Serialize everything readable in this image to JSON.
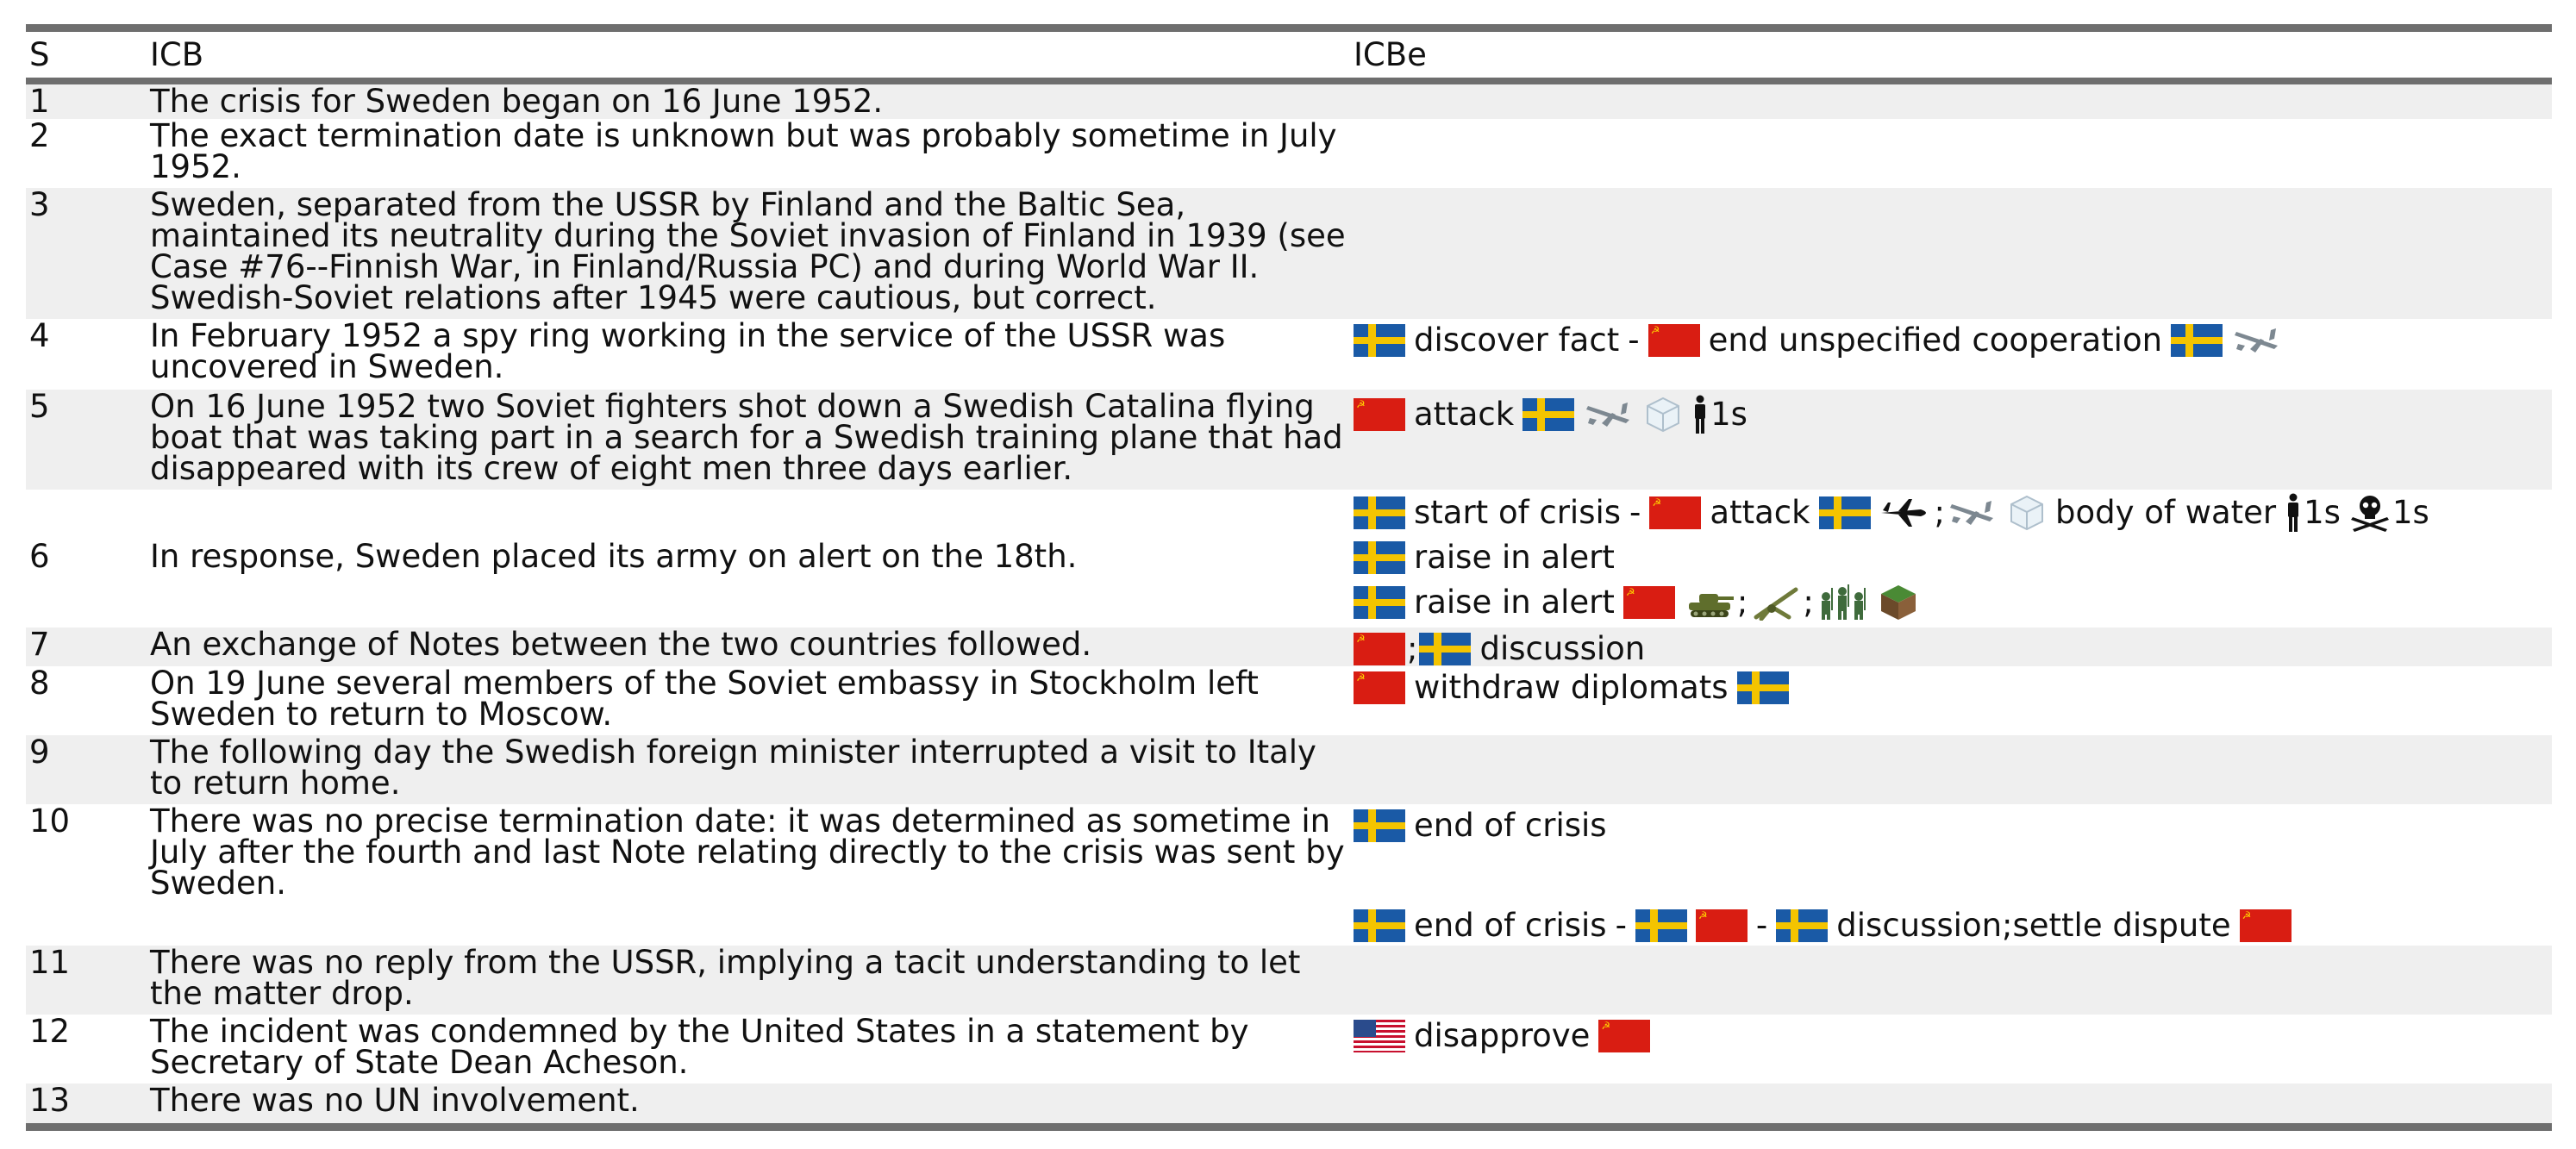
{
  "header": {
    "s": "S",
    "icb": "ICB",
    "icbe": "ICBe"
  },
  "colors": {
    "rule": "#6e6e6e",
    "stripe": "#efefef",
    "sweden_blue": "#1a5aa6",
    "sweden_yellow": "#f4c400",
    "ussr_red": "#d91d12"
  },
  "rows": [
    {
      "s": "1",
      "icb": "The crisis for Sweden began on 16 June 1952."
    },
    {
      "s": "2",
      "icb": "The exact termination date is unknown but was probably sometime in July 1952."
    },
    {
      "s": "3",
      "icb": "Sweden, separated from the USSR by Finland and the Baltic Sea, maintained its neutrality during the Soviet invasion of Finland in 1939 (see Case #76--Finnish War, in Finland/Russia PC) and during World War II. Swedish-Soviet relations after 1945 were cautious, but correct."
    },
    {
      "s": "4",
      "icb": "In February 1952 a spy ring working in the service of the USSR was uncovered in Sweden."
    },
    {
      "s": "5",
      "icb": "On 16 June 1952 two Soviet fighters shot down a Swedish Catalina flying boat that was taking part in a search for a Swedish training plane that had disappeared with its crew of eight men three days earlier."
    },
    {
      "s": "6",
      "icb": "In response, Sweden placed its army on alert on the 18th."
    },
    {
      "s": "7",
      "icb": "An exchange of Notes between the two countries followed."
    },
    {
      "s": "8",
      "icb": "On 19 June several members of the Soviet embassy in Stockholm left Sweden to return to Moscow."
    },
    {
      "s": "9",
      "icb": "The following day the Swedish foreign minister interrupted a visit to Italy to return home."
    },
    {
      "s": "10",
      "icb": "There was no precise termination date: it was determined as sometime in July after the fourth and last Note relating directly to the crisis was sent by Sweden."
    },
    {
      "s": "11",
      "icb": "There was no reply from the USSR, implying a tacit understanding to let the matter drop."
    },
    {
      "s": "12",
      "icb": "The incident was condemned by the United States in a statement by Secretary of State Dean Acheson."
    },
    {
      "s": "13",
      "icb": "There was no UN involvement."
    }
  ],
  "events": {
    "r4": {
      "discover": "discover fact",
      "dash": "-",
      "end_coop": "end unspecified cooperation"
    },
    "r5": {
      "attack": "attack",
      "water": "body of water",
      "count": "1s"
    },
    "r6a": {
      "start": "start of crisis",
      "dash": "-",
      "attack": "attack",
      "semi": ";",
      "water": "body of water",
      "count1": "1s",
      "count2": "1s"
    },
    "r6b": {
      "alert": "raise in alert"
    },
    "r6c": {
      "alert": "raise in alert",
      "semi1": ";",
      "semi2": ";"
    },
    "r7": {
      "semi": ";",
      "discussion": "discussion"
    },
    "r8": {
      "withdraw": "withdraw diplomats"
    },
    "r10a": {
      "end": "end of crisis"
    },
    "r10b": {
      "end": "end of crisis",
      "dash1": "-",
      "dash2": "-",
      "discuss": "discussion;settle dispute"
    },
    "r12": {
      "disapprove": "disapprove"
    }
  }
}
